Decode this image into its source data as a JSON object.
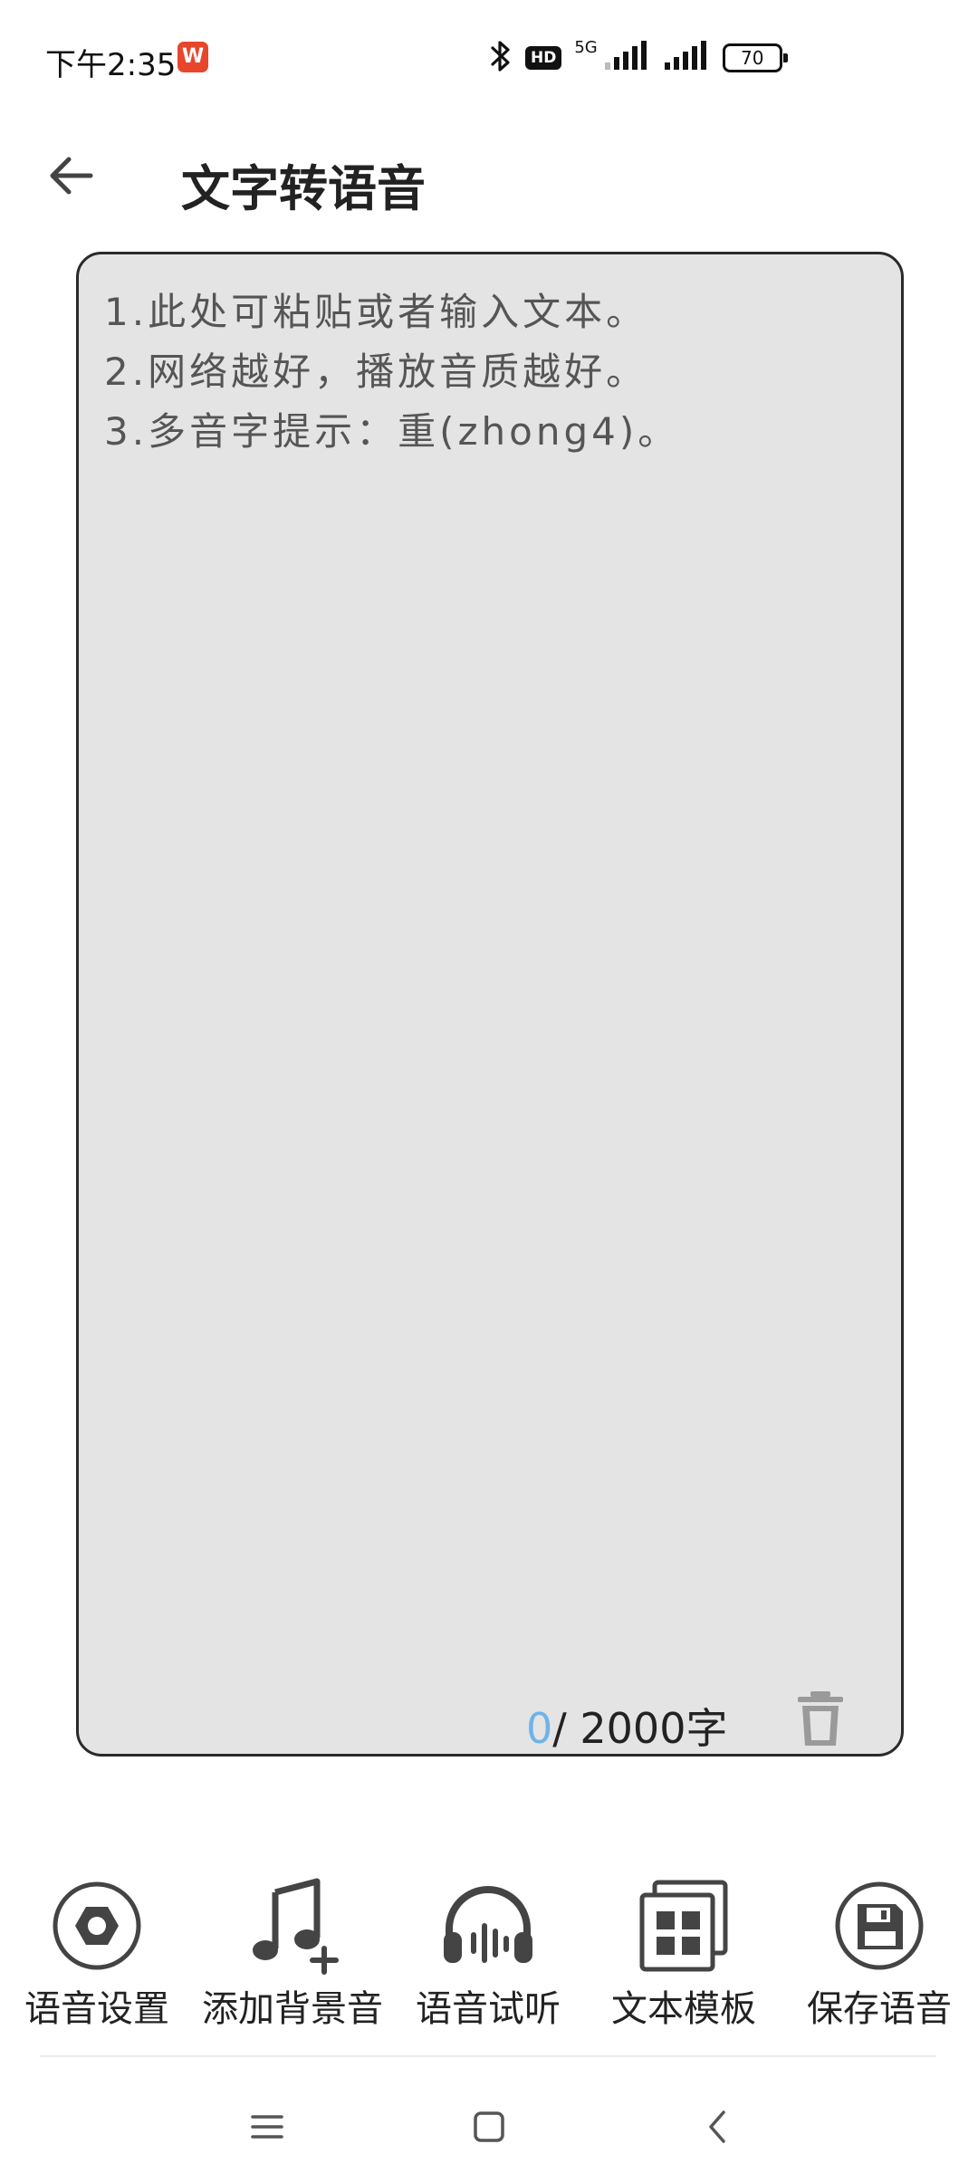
{
  "status_bar": {
    "time": "下午2:35",
    "app_badge": "W",
    "hd_label": "HD",
    "network_label": "5G",
    "battery_level": "70"
  },
  "header": {
    "title": "文字转语音"
  },
  "editor": {
    "hints": [
      "1.此处可粘贴或者输入文本。",
      "2.网络越好，播放音质越好。",
      "3.多音字提示：重(zhong4)。"
    ],
    "char_count_current": "0",
    "char_count_max": "/ 2000字"
  },
  "toolbar": {
    "items": [
      {
        "label": "语音设置",
        "icon": "gear-icon"
      },
      {
        "label": "添加背景音",
        "icon": "music-add-icon"
      },
      {
        "label": "语音试听",
        "icon": "headphones-icon"
      },
      {
        "label": "文本模板",
        "icon": "template-grid-icon"
      },
      {
        "label": "保存语音",
        "icon": "save-icon"
      }
    ]
  },
  "colors": {
    "accent": "#6fb3ea",
    "icon": "#444444",
    "card_bg": "#e4e4e4"
  }
}
